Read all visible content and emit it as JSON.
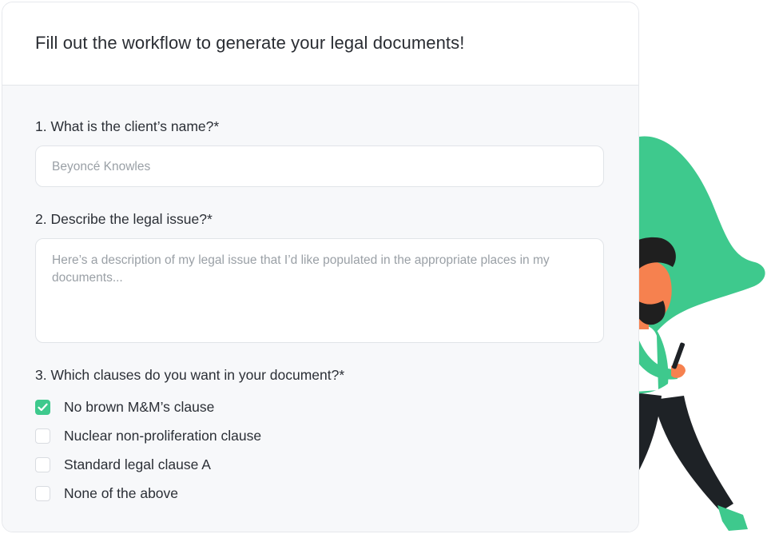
{
  "header": {
    "title": "Fill out the workflow to generate your legal documents!"
  },
  "questions": {
    "q1": {
      "label": "1. What is the client’s name?*",
      "placeholder": "Beyoncé Knowles"
    },
    "q2": {
      "label": "2. Describe the legal issue?*",
      "placeholder": "Here’s a description of my legal issue that I’d like populated in the appropriate places in my documents..."
    },
    "q3": {
      "label": "3. Which clauses do you want in your document?*",
      "options": [
        {
          "label": "No brown M&M’s clause",
          "checked": true
        },
        {
          "label": "Nuclear non-proliferation clause",
          "checked": false
        },
        {
          "label": "Standard legal clause A",
          "checked": false
        },
        {
          "label": "None of the above",
          "checked": false
        }
      ]
    }
  },
  "colors": {
    "accent": "#3ec98d",
    "skin": "#f6814f",
    "hair": "#1f1f1f",
    "pants": "#1e2226"
  },
  "illustration": {
    "name": "man-walking-with-phone"
  }
}
